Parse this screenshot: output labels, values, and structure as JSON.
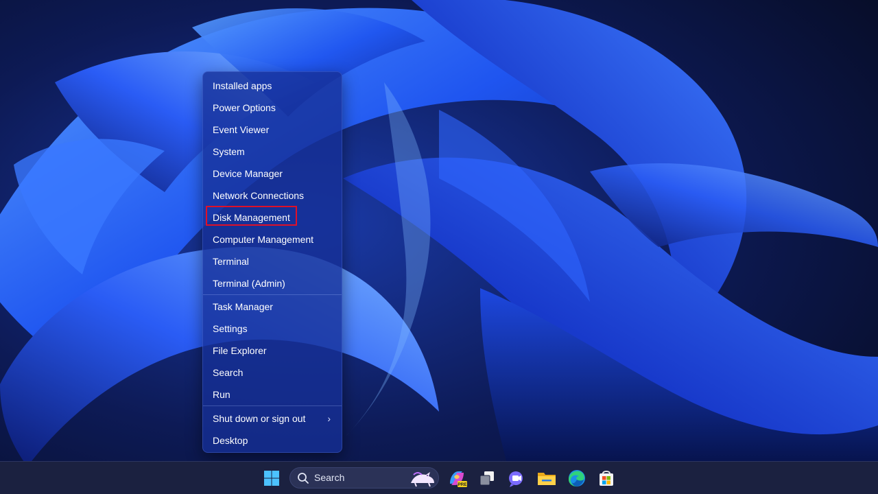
{
  "menu": {
    "items": [
      {
        "label": "Installed apps"
      },
      {
        "label": "Power Options"
      },
      {
        "label": "Event Viewer"
      },
      {
        "label": "System"
      },
      {
        "label": "Device Manager"
      },
      {
        "label": "Network Connections"
      },
      {
        "label": "Disk Management",
        "highlighted": true
      },
      {
        "label": "Computer Management"
      },
      {
        "label": "Terminal"
      },
      {
        "label": "Terminal (Admin)"
      },
      {
        "label": "Task Manager"
      },
      {
        "label": "Settings"
      },
      {
        "label": "File Explorer"
      },
      {
        "label": "Search"
      },
      {
        "label": "Run"
      },
      {
        "label": "Shut down or sign out",
        "icon": "chevron-right-icon"
      },
      {
        "label": "Desktop"
      }
    ],
    "highlight_color": "#e01028"
  },
  "taskbar": {
    "search_label": "Search",
    "icons": [
      "start-icon",
      "search-icon",
      "copilot-icon",
      "task-view-icon",
      "teams-chat-icon",
      "file-explorer-icon",
      "edge-icon",
      "store-icon"
    ]
  },
  "colors": {
    "menu_background": "#1630a0",
    "taskbar_background": "#1b2140",
    "accent": "#2f6bff"
  }
}
